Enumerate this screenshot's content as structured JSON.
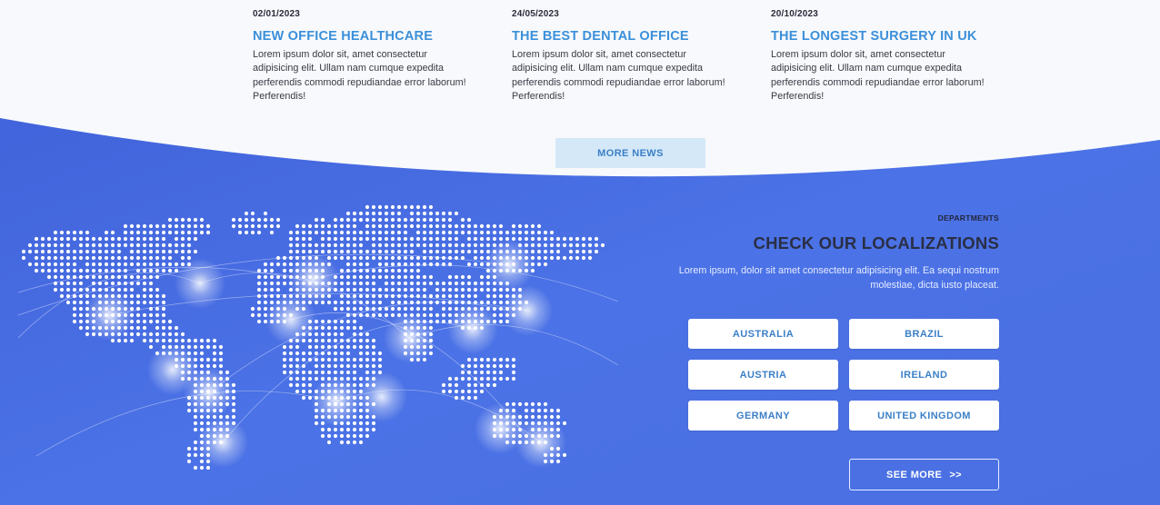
{
  "news": [
    {
      "date": "02/01/2023",
      "title": "NEW OFFICE HEALTHCARE",
      "body": "Lorem ipsum dolor sit, amet consectetur adipisicing elit. Ullam nam cumque expedita perferendis commodi repudiandae error laborum! Perferendis!"
    },
    {
      "date": "24/05/2023",
      "title": "THE BEST DENTAL OFFICE",
      "body": "Lorem ipsum dolor sit, amet consectetur adipisicing elit. Ullam nam cumque expedita perferendis commodi repudiandae error laborum! Perferendis!"
    },
    {
      "date": "20/10/2023",
      "title": "THE LONGEST SURGERY IN UK",
      "body": "Lorem ipsum dolor sit, amet consectetur adipisicing elit. Ullam nam cumque expedita perferendis commodi repudiandae error laborum! Perferendis!"
    }
  ],
  "more_news_label": "MORE NEWS",
  "departments": {
    "eyebrow": "DEPARTMENTS",
    "heading": "CHECK OUR LOCALIZATIONS",
    "description": "Lorem ipsum, dolor sit amet consectetur adipisicing elit. Ea sequi nostrum molestiae, dicta iusto placeat.",
    "locations": [
      "AUSTRALIA",
      "BRAZIL",
      "AUSTRIA",
      "IRELAND",
      "GERMANY",
      "UNITED KINGDOM"
    ],
    "see_more_label": "SEE MORE",
    "see_more_arrows": ">>"
  },
  "colors": {
    "accent_blue": "#3b8fd9",
    "section_blue": "#4a6fe2",
    "button_light": "#d4e8f8"
  },
  "icons": {
    "world_map": "dotted-world-map-icon"
  }
}
